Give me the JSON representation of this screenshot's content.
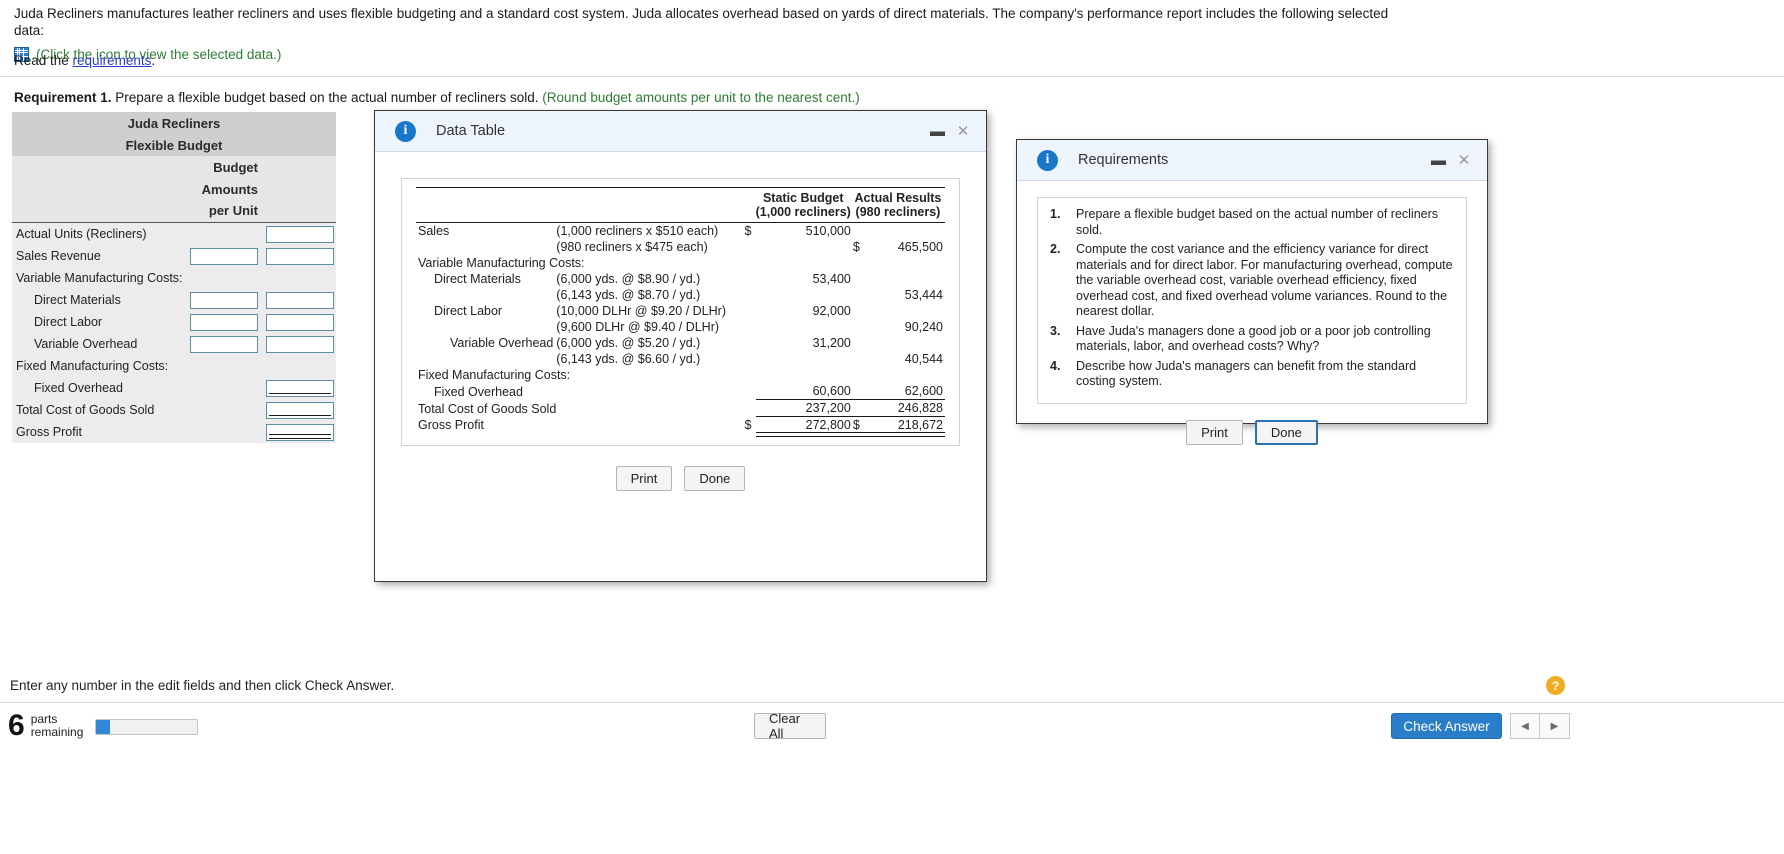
{
  "problem": {
    "statement": "Juda Recliners manufactures leather recliners and uses flexible budgeting and a standard cost system. Juda allocates overhead based on yards of direct materials. The company's performance report includes the following selected data:",
    "icon_link_text": "(Click the icon to view the selected data.)",
    "read_prefix": "Read the ",
    "read_link": "requirements",
    "read_suffix": ".",
    "requirement_label": "Requirement 1.",
    "requirement_text": " Prepare a flexible budget based on the actual number of recliners sold. ",
    "requirement_hint": "(Round budget amounts per unit to the nearest cent.)"
  },
  "budget_table": {
    "title_line1": "Juda Recliners",
    "title_line2": "Flexible Budget",
    "sub_line1": "Budget",
    "sub_line2": "Amounts",
    "sub_line3": "per Unit",
    "rows": [
      {
        "label": "Actual Units (Recliners)",
        "indent": 0,
        "fields": [
          "none",
          "plain"
        ]
      },
      {
        "label": "Sales Revenue",
        "indent": 0,
        "fields": [
          "plain",
          "plain"
        ]
      },
      {
        "label": "Variable Manufacturing Costs:",
        "indent": 0,
        "fields": [
          "none",
          "none"
        ]
      },
      {
        "label": "Direct Materials",
        "indent": 1,
        "fields": [
          "plain",
          "plain"
        ]
      },
      {
        "label": "Direct Labor",
        "indent": 1,
        "fields": [
          "plain",
          "plain"
        ]
      },
      {
        "label": "Variable Overhead",
        "indent": 1,
        "fields": [
          "plain",
          "plain"
        ]
      },
      {
        "label": "Fixed Manufacturing Costs:",
        "indent": 0,
        "fields": [
          "none",
          "none"
        ]
      },
      {
        "label": "Fixed Overhead",
        "indent": 1,
        "fields": [
          "none",
          "underline"
        ]
      },
      {
        "label": "Total Cost of Goods Sold",
        "indent": 0,
        "fields": [
          "none",
          "underline"
        ]
      },
      {
        "label": "Gross Profit",
        "indent": 0,
        "fields": [
          "none",
          "double"
        ]
      }
    ]
  },
  "data_table_modal": {
    "title": "Data Table",
    "info_icon": "info-icon",
    "minimize_icon": "minimize-icon",
    "close_icon": "close-icon",
    "headers": {
      "col1_line1": "Static Budget",
      "col1_line2": "(1,000 recliners)",
      "col2_line1": "Actual Results",
      "col2_line2": "(980 recliners)"
    },
    "rows": [
      {
        "item": "Sales",
        "indent": 0,
        "desc": "(1,000 recliners x $510 each)",
        "d1": "$",
        "v1": "510,000",
        "d2": "",
        "v2": ""
      },
      {
        "item": "",
        "indent": 0,
        "desc": "(980 recliners x $475 each)",
        "d1": "",
        "v1": "",
        "d2": "$",
        "v2": "465,500"
      },
      {
        "item": "Variable Manufacturing Costs:",
        "indent": 0,
        "desc": "",
        "d1": "",
        "v1": "",
        "d2": "",
        "v2": ""
      },
      {
        "item": "Direct Materials",
        "indent": 1,
        "desc": "(6,000 yds. @ $8.90 / yd.)",
        "d1": "",
        "v1": "53,400",
        "d2": "",
        "v2": ""
      },
      {
        "item": "",
        "indent": 1,
        "desc": "(6,143 yds. @ $8.70 / yd.)",
        "d1": "",
        "v1": "",
        "d2": "",
        "v2": "53,444"
      },
      {
        "item": "Direct Labor",
        "indent": 1,
        "desc": "(10,000 DLHr @ $9.20 / DLHr)",
        "d1": "",
        "v1": "92,000",
        "d2": "",
        "v2": ""
      },
      {
        "item": "",
        "indent": 1,
        "desc": "(9,600 DLHr @ $9.40 / DLHr)",
        "d1": "",
        "v1": "",
        "d2": "",
        "v2": "90,240"
      },
      {
        "item": "Variable Overhead",
        "indent": 2,
        "desc": "(6,000 yds. @ $5.20 / yd.)",
        "d1": "",
        "v1": "31,200",
        "d2": "",
        "v2": ""
      },
      {
        "item": "",
        "indent": 1,
        "desc": "(6,143 yds. @ $6.60 / yd.)",
        "d1": "",
        "v1": "",
        "d2": "",
        "v2": "40,544"
      },
      {
        "item": "Fixed Manufacturing Costs:",
        "indent": 0,
        "desc": "",
        "d1": "",
        "v1": "",
        "d2": "",
        "v2": ""
      },
      {
        "item": "Fixed Overhead",
        "indent": 1,
        "desc": "",
        "d1": "",
        "v1": "60,600",
        "d2": "",
        "v2": "62,600",
        "rule": "single"
      },
      {
        "item": "Total Cost of Goods Sold",
        "indent": 0,
        "desc": "",
        "d1": "",
        "v1": "237,200",
        "d2": "",
        "v2": "246,828",
        "rule": "single"
      },
      {
        "item": "Gross Profit",
        "indent": 0,
        "desc": "",
        "d1": "$",
        "v1": "272,800",
        "d2": "$",
        "v2": "218,672",
        "rule": "double"
      }
    ],
    "print_label": "Print",
    "done_label": "Done"
  },
  "requirements_modal": {
    "title": "Requirements",
    "info_icon": "info-icon",
    "minimize_icon": "minimize-icon",
    "close_icon": "close-icon",
    "items": [
      {
        "num": "1.",
        "text": "Prepare a flexible budget based on the actual number of recliners sold."
      },
      {
        "num": "2.",
        "text": "Compute the cost variance and the efficiency variance for direct materials and for direct labor. For manufacturing overhead, compute the variable overhead cost, variable overhead efficiency, fixed overhead cost, and fixed overhead volume variances. Round to the nearest dollar."
      },
      {
        "num": "3.",
        "text": "Have Juda's managers done a good job or a poor job controlling materials, labor, and overhead costs? Why?"
      },
      {
        "num": "4.",
        "text": "Describe how Juda's managers can benefit from the standard costing system."
      }
    ],
    "print_label": "Print",
    "done_label": "Done"
  },
  "footer": {
    "hint": "Enter any number in the edit fields and then click Check Answer.",
    "parts_number": "6",
    "parts_label_line1": "parts",
    "parts_label_line2": "remaining",
    "progress_percent": 14,
    "clear_all_label": "Clear All",
    "check_answer_label": "Check Answer",
    "prev_icon": "chevron-left-icon",
    "next_icon": "chevron-right-icon",
    "help_icon": "question-mark-icon",
    "help_label": "?"
  },
  "colors": {
    "accent": "#2a7ec9",
    "green": "#2e7d33",
    "link": "#2b3ad1",
    "info": "#1877c9",
    "progress": "#3187d6"
  }
}
